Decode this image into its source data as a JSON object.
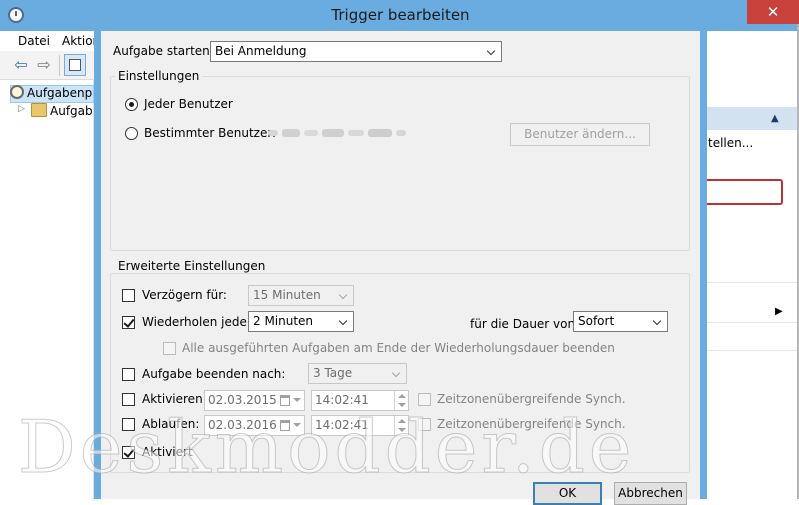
{
  "background_window": {
    "menu": [
      "Datei",
      "Aktion"
    ],
    "tree": [
      {
        "label": "Aufgabenp",
        "icon": "clock-icon"
      },
      {
        "label": "Aufgab",
        "icon": "folder-clock-icon"
      }
    ],
    "close_glyph": "✕",
    "actions_panel": {
      "item": "tellen..."
    }
  },
  "dialog": {
    "title": "Trigger bearbeiten",
    "start_task": {
      "label": "Aufgabe starten:",
      "value": "Bei Anmeldung"
    },
    "settings": {
      "title": "Einstellungen",
      "any_user_label": "Jeder Benutzer",
      "specific_user_label": "Bestimmter Benutzer:",
      "change_user_button": "Benutzer ändern..."
    },
    "advanced": {
      "title": "Erweiterte Einstellungen",
      "delay": {
        "label": "Verzögern für:",
        "value": "15 Minuten"
      },
      "repeat": {
        "label": "Wiederholen jede:",
        "value": "2 Minuten"
      },
      "duration": {
        "label": "für die Dauer von:",
        "value": "Sofort"
      },
      "stop_all": {
        "label": "Alle ausgeführten Aufgaben am Ende der Wiederholungsdauer beenden"
      },
      "stop_after": {
        "label": "Aufgabe beenden nach:",
        "value": "3 Tage"
      },
      "activate": {
        "label": "Aktivieren:",
        "date": "02.03.2015",
        "time": "14:02:41",
        "sync_label": "Zeitzonenübergreifende Synch."
      },
      "expire": {
        "label": "Ablaufen:",
        "date": "02.03.2016",
        "time": "14:02:41",
        "sync_label": "Zeitzonenübergreifende Synch."
      },
      "enabled": {
        "label": "Aktiviert"
      }
    },
    "ok_button": "OK",
    "cancel_button": "Abbrechen"
  },
  "watermark": "Deskmodder.de"
}
